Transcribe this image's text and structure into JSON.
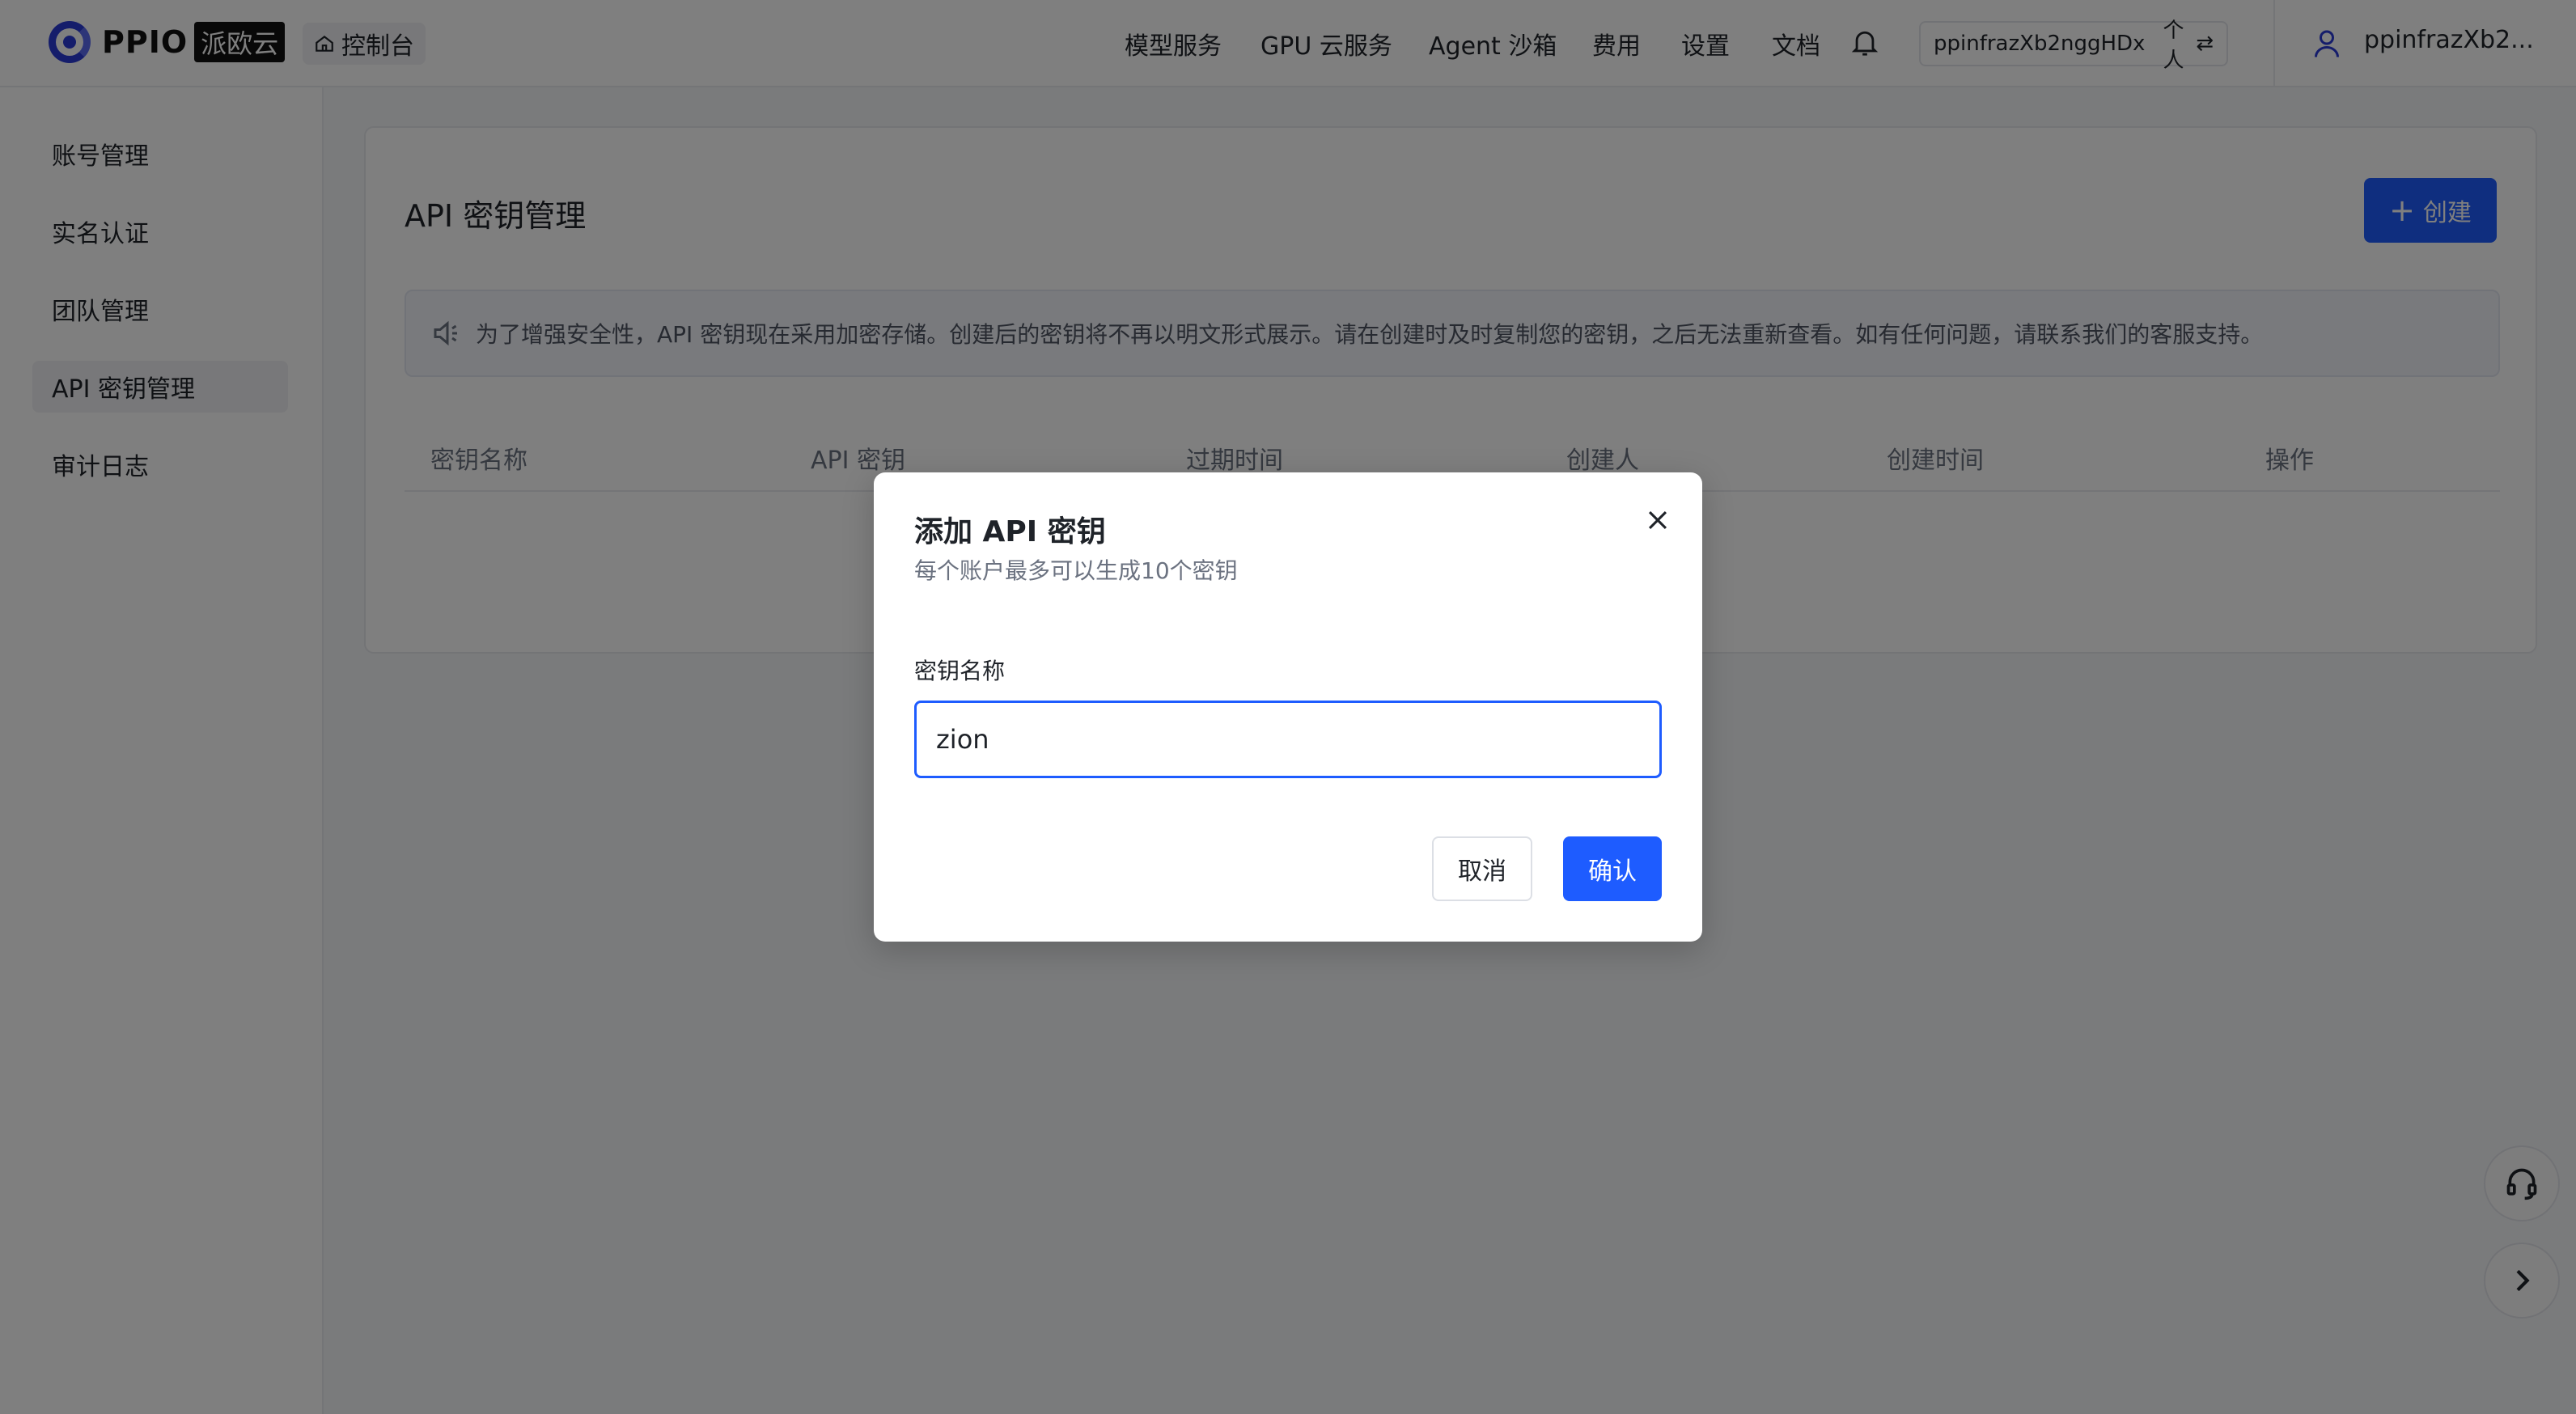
{
  "header": {
    "brand": "PPIO",
    "brand_badge": "派欧云",
    "console_label": "控制台",
    "nav": [
      "模型服务",
      "GPU 云服务",
      "Agent 沙箱",
      "费用",
      "设置",
      "文档"
    ],
    "account_id": "ppinfrazXb2nggHDx",
    "account_type": "个人",
    "user_name": "ppinfrazXb2..."
  },
  "sidebar": {
    "items": [
      {
        "label": "账号管理"
      },
      {
        "label": "实名认证"
      },
      {
        "label": "团队管理"
      },
      {
        "label": "API 密钥管理"
      },
      {
        "label": "审计日志"
      }
    ]
  },
  "main": {
    "title": "API 密钥管理",
    "create_label": "创建",
    "notice": "为了增强安全性，API 密钥现在采用加密存储。创建后的密钥将不再以明文形式展示。请在创建时及时复制您的密钥，之后无法重新查看。如有任何问题，请联系我们的客服支持。",
    "columns": [
      "密钥名称",
      "API 密钥",
      "过期时间",
      "创建人",
      "创建时间",
      "操作"
    ]
  },
  "modal": {
    "title": "添加 API 密钥",
    "subtitle": "每个账户最多可以生成10个密钥",
    "field_label": "密钥名称",
    "field_value": "zion",
    "cancel_label": "取消",
    "confirm_label": "确认"
  },
  "colors": {
    "accent": "#1e5cff",
    "overlay": "rgba(0,0,0,0.5)"
  }
}
